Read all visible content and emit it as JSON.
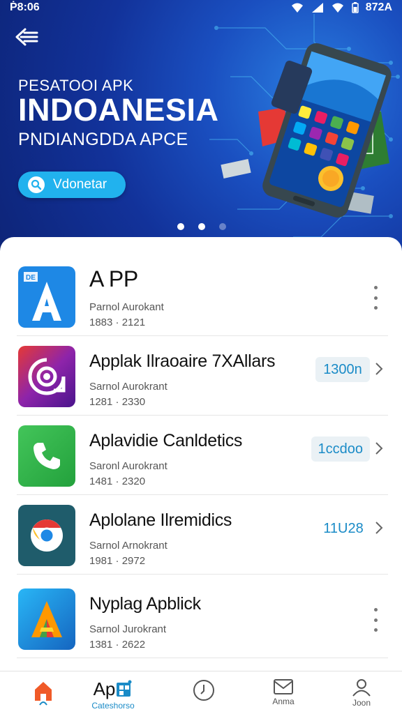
{
  "status_bar": {
    "time": "Ṗ8:06",
    "battery": "872A"
  },
  "hero": {
    "subtitle_top": "PESATOOI APK",
    "title": "INDOANESIA",
    "subtitle_bottom": "PNDIANGDDA APCE",
    "search_button_label": "Vdonetar",
    "carousel_dots": 3,
    "active_dot": 1
  },
  "apps": [
    {
      "name": "A PP",
      "subtitle": "Parnol Aurokant",
      "range": "1883 · 2121",
      "action": "menu",
      "icon": "app-letter-a-icon",
      "icon_color": "#1e88e5"
    },
    {
      "name": "Applak Ilraoaire 7XAllars",
      "subtitle": "Sarnol Aurokrant",
      "range": "1281 · 2330",
      "action": "badge",
      "badge": "1300n",
      "icon": "camera-app-icon",
      "icon_color": "#c2185b"
    },
    {
      "name": "Aplavidie Canldetics",
      "subtitle": "Saronl Aurokrant",
      "range": "1481 · 2320",
      "action": "badge",
      "badge": "1ccdoo",
      "icon": "phone-icon",
      "icon_color": "#2fb54a"
    },
    {
      "name": "Aplolane Ilremidics",
      "subtitle": "Sarnol Arnokrant",
      "range": "1981 · 2972",
      "action": "plain",
      "badge": "11U28",
      "icon": "chrome-icon",
      "icon_color": "#1f5c6b"
    },
    {
      "name": "Nyplag Apblick",
      "subtitle": "Sarnol Jurokrant",
      "range": "1381 · 2622",
      "action": "menu",
      "icon": "artstudio-icon",
      "icon_color": "#1976d2"
    }
  ],
  "bottom_nav": [
    {
      "label": "",
      "icon": "home-icon"
    },
    {
      "label": "Cateshorso",
      "icon": "apps-icon",
      "text": "Ap"
    },
    {
      "label": "",
      "icon": "clock-icon"
    },
    {
      "label": "Anma",
      "icon": "mail-icon"
    },
    {
      "label": "Joon",
      "icon": "profile-icon"
    }
  ],
  "colors": {
    "accent": "#1a8bc7",
    "hero_dark": "#0d2477",
    "search_button": "#21b2ee"
  }
}
